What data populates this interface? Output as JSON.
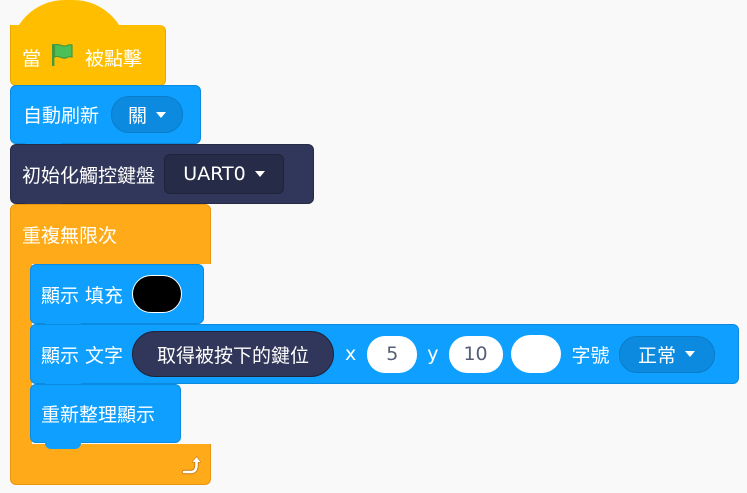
{
  "hat_block": {
    "label_before": "當",
    "flag_icon": "green-flag-icon",
    "label_after": "被點擊"
  },
  "auto_refresh": {
    "label": "自動刷新",
    "dropdown_value": "關"
  },
  "init_keyboard": {
    "label": "初始化觸控鍵盤",
    "dropdown_value": "UART0"
  },
  "forever": {
    "label": "重複無限次",
    "loop_icon": "loop-arrow-icon"
  },
  "fill_block": {
    "label": "顯示 填充",
    "color_value": "#000000"
  },
  "text_block": {
    "label": "顯示 文字",
    "reporter_label": "取得被按下的鍵位",
    "x_label": "x",
    "x_value": "5",
    "y_label": "y",
    "y_value": "10",
    "color_value": "#ffffff",
    "size_label": "字號",
    "size_value": "正常"
  },
  "refresh_block": {
    "label": "重新整理顯示"
  },
  "colors": {
    "events": "#ffbf00",
    "events_dark": "#e6a800",
    "display": "#0fa0ff",
    "display_dark": "#0b8ae0",
    "keyboard": "#31375a",
    "control": "#ffab19",
    "control_dark": "#e89610"
  }
}
